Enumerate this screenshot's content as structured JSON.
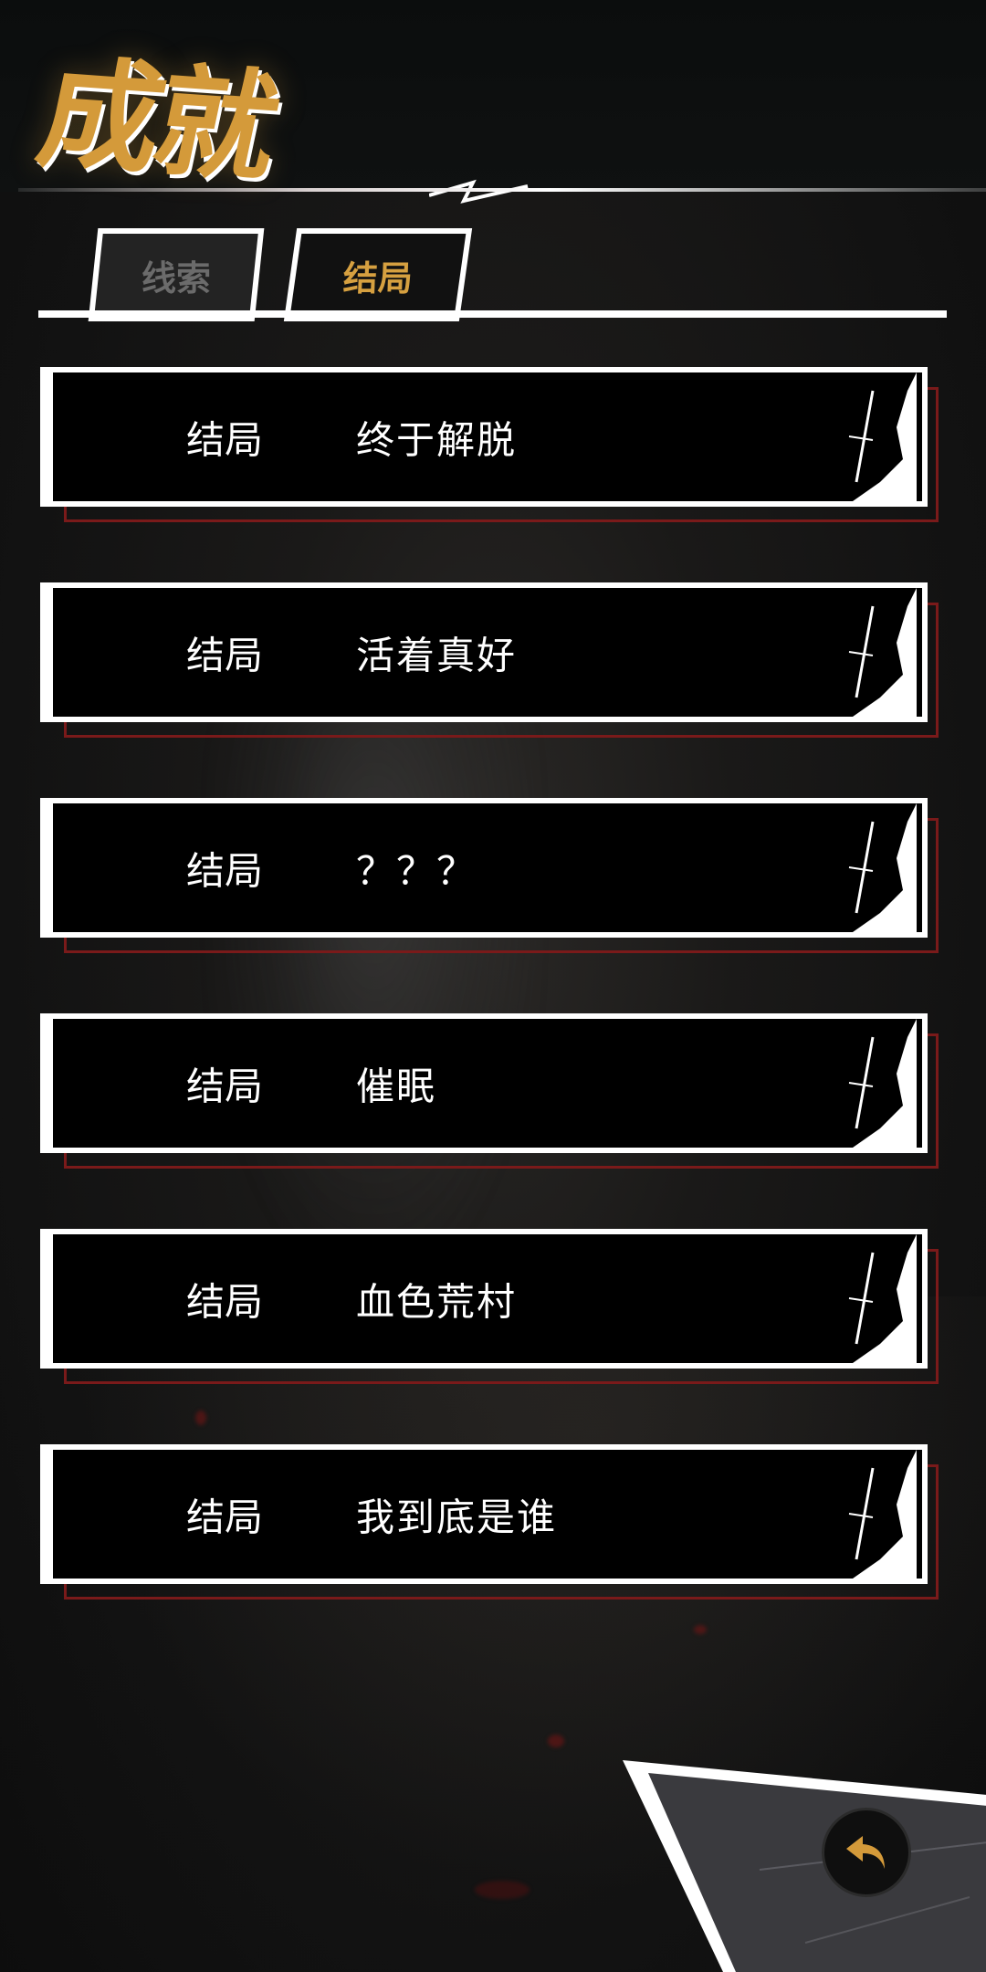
{
  "header": {
    "title": "成就"
  },
  "tabs": [
    {
      "label": "线索",
      "active": false
    },
    {
      "label": "结局",
      "active": true
    }
  ],
  "endings": [
    {
      "label": "结局",
      "name": "终于解脱"
    },
    {
      "label": "结局",
      "name": "活着真好"
    },
    {
      "label": "结局",
      "name": "？？？"
    },
    {
      "label": "结局",
      "name": "催眠"
    },
    {
      "label": "结局",
      "name": "血色荒村"
    },
    {
      "label": "结局",
      "name": "我到底是谁"
    }
  ],
  "back_button": {
    "icon": "back-arrow-icon"
  },
  "colors": {
    "accent": "#d49a3a",
    "card_bg": "#000000",
    "card_border": "#ffffff",
    "shadow_border": "#7a1a1a"
  }
}
